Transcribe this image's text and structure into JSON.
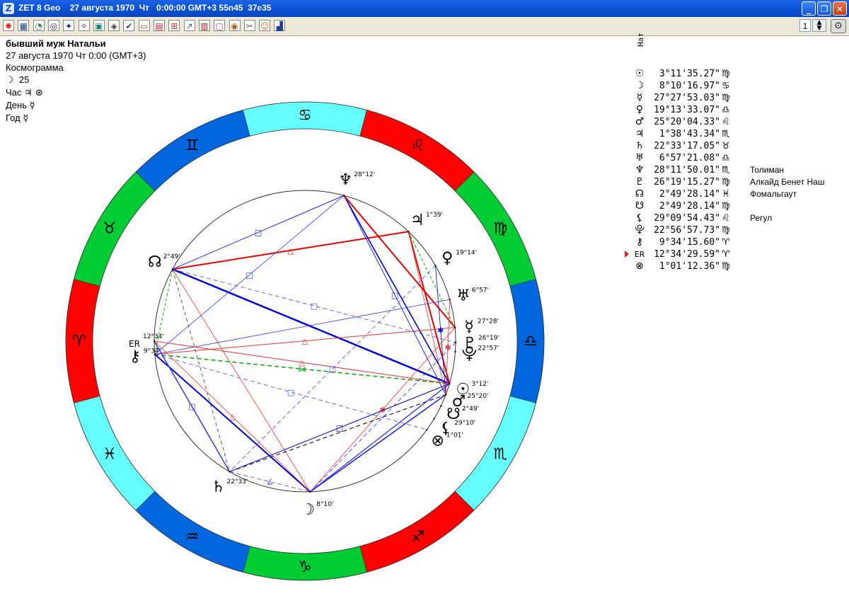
{
  "window": {
    "title": "ZET 8 Geo    27 августа 1970  Чт   0:00:00 GMT+3 55n45  37e35",
    "icon": "Z",
    "minimize": "_",
    "maximize": "❐",
    "close": "✕"
  },
  "toolbar": {
    "buttons": [
      {
        "name": "sun-tool-icon",
        "glyph": "✺",
        "color": "#d02010"
      },
      {
        "name": "table-tool-icon",
        "glyph": "▦",
        "color": "#204080"
      },
      {
        "name": "pie-tool-icon",
        "glyph": "◔",
        "color": "#208040"
      },
      {
        "name": "circle-tool-icon",
        "glyph": "◎",
        "color": "#202060"
      },
      {
        "name": "star-map-icon",
        "glyph": "✦",
        "color": "#1030a0"
      },
      {
        "name": "night-sky-icon",
        "glyph": "✧",
        "color": "#102080"
      },
      {
        "name": "map-tool-icon",
        "glyph": "▣",
        "color": "#108060"
      },
      {
        "name": "diagram-tool-icon",
        "glyph": "◈",
        "color": "#404040"
      },
      {
        "name": "check-tool-icon",
        "glyph": "✔",
        "color": "#2040c0"
      },
      {
        "name": "folder-tool-icon",
        "glyph": "▭",
        "color": "#806020"
      },
      {
        "name": "grid-tool-icon",
        "glyph": "▤",
        "color": "#c02020"
      },
      {
        "name": "plus-grid-icon",
        "glyph": "⊞",
        "color": "#c03030"
      },
      {
        "name": "arrow-tool-icon",
        "glyph": "↗",
        "color": "#2060a0"
      },
      {
        "name": "calc-tool-icon",
        "glyph": "▥",
        "color": "#a02020"
      },
      {
        "name": "doc-tool-icon",
        "glyph": "▢",
        "color": "#8040a0"
      },
      {
        "name": "zodiac-wheel-icon",
        "glyph": "◉",
        "color": "#a06020"
      },
      {
        "name": "tools-icon",
        "glyph": "✂",
        "color": "#606060"
      },
      {
        "name": "person-tool-icon",
        "glyph": "☺",
        "color": "#c07020"
      },
      {
        "name": "chart-bars-icon",
        "glyph": "▟",
        "color": "#2040a0"
      }
    ],
    "page_number": "1",
    "spin_up": "▲",
    "spin_down": "▼",
    "zoom": "⊙"
  },
  "info": {
    "name": "бывший муж Натальи",
    "date_line": "27 августа 1970  Чт   0:00 (GMT+3)",
    "chart_type": "Космограмма",
    "moon_symbol": "☽",
    "moon_day": "25",
    "hour_label": "Час",
    "hour_symbols": "♃ ⊛",
    "day_label": "День",
    "day_symbol": "☿",
    "year_label": "Год",
    "year_symbol": "☿"
  },
  "table_header": "Нат",
  "planets": [
    {
      "glyph": "☉",
      "deg": "3°11'35.27\"",
      "sign": "♍",
      "star": ""
    },
    {
      "glyph": "☽",
      "deg": "8°10'16.97\"",
      "sign": "♋",
      "star": ""
    },
    {
      "glyph": "☿",
      "deg": "27°27'53.03\"",
      "sign": "♍",
      "star": ""
    },
    {
      "glyph": "♀",
      "deg": "19°13'33.07\"",
      "sign": "♎",
      "star": ""
    },
    {
      "glyph": "♂",
      "deg": "25°20'04.33\"",
      "sign": "♌",
      "star": ""
    },
    {
      "glyph": "♃",
      "deg": "1°38'43.34\"",
      "sign": "♏",
      "star": ""
    },
    {
      "glyph": "♄",
      "deg": "22°33'17.05\"",
      "sign": "♉",
      "star": ""
    },
    {
      "glyph": "♅",
      "deg": "6°57'21.08\"",
      "sign": "♎",
      "star": ""
    },
    {
      "glyph": "♆",
      "deg": "28°11'50.01\"",
      "sign": "♏",
      "star": "Толиман"
    },
    {
      "glyph": "♇",
      "deg": "26°19'15.27\"",
      "sign": "♍",
      "star": "Алкайд Бенет Наш"
    },
    {
      "glyph": "☊",
      "deg": "2°49'28.14\"",
      "sign": "♓",
      "star": "Фомальгаут"
    },
    {
      "glyph": "☋",
      "deg": "2°49'28.14\"",
      "sign": "♍",
      "star": ""
    },
    {
      "glyph": "⚸",
      "deg": "29°09'54.43\"",
      "sign": "♌",
      "star": "Регул"
    },
    {
      "glyph": "⯓",
      "deg": "22°56'57.73\"",
      "sign": "♍",
      "star": ""
    },
    {
      "glyph": "⚷",
      "deg": "9°34'15.60\"",
      "sign": "♈",
      "star": ""
    },
    {
      "glyph": "ER",
      "deg": "12°34'29.59\"",
      "sign": "♈",
      "star": "",
      "marked": true
    },
    {
      "glyph": "⊗",
      "deg": "1°01'12.36\"",
      "sign": "♍",
      "star": ""
    }
  ],
  "zodiac": {
    "signs": [
      {
        "glyph": "♈",
        "color": "#ff0000"
      },
      {
        "glyph": "♉",
        "color": "#00cc33"
      },
      {
        "glyph": "♊",
        "color": "#0066dd"
      },
      {
        "glyph": "♋",
        "color": "#66ffff"
      },
      {
        "glyph": "♌",
        "color": "#ff0000"
      },
      {
        "glyph": "♍",
        "color": "#00cc33"
      },
      {
        "glyph": "♎",
        "color": "#0066dd"
      },
      {
        "glyph": "♏",
        "color": "#66ffff"
      },
      {
        "glyph": "♐",
        "color": "#ff0000"
      },
      {
        "glyph": "♑",
        "color": "#00cc33"
      },
      {
        "glyph": "♒",
        "color": "#0066dd"
      },
      {
        "glyph": "♓",
        "color": "#66ffff"
      }
    ]
  },
  "chart_points": [
    {
      "id": "sun",
      "glyph": "☉",
      "label": "3°12'",
      "angle": -16.4
    },
    {
      "id": "moon",
      "glyph": "☽",
      "label": "8°10'",
      "angle": -88
    },
    {
      "id": "mars",
      "glyph": "♂",
      "label": "25°20'",
      "angle": -20.8
    },
    {
      "id": "mercury",
      "glyph": "☿",
      "label": "27°28'",
      "angle": 5.2
    },
    {
      "id": "venus",
      "glyph": "♀",
      "label": "19°14'",
      "angle": 30
    },
    {
      "id": "jupiter",
      "glyph": "♃",
      "label": "1°39'",
      "angle": 46.6
    },
    {
      "id": "saturn",
      "glyph": "♄",
      "label": "22°33'",
      "angle": -120
    },
    {
      "id": "uranus",
      "glyph": "♅",
      "label": "6°57'",
      "angle": 16
    },
    {
      "id": "neptune",
      "glyph": "♆",
      "label": "28°12'",
      "angle": 75
    },
    {
      "id": "pluto",
      "glyph": "♇",
      "label": "26°19'",
      "angle": -0.5
    },
    {
      "id": "north-node",
      "glyph": "☊",
      "label": "2°49'",
      "angle": 151.5
    },
    {
      "id": "south-node",
      "glyph": "☋",
      "label": "2°49'",
      "angle": -25.5
    },
    {
      "id": "lilith",
      "glyph": "⚸",
      "label": "29°10'",
      "angle": -31
    },
    {
      "id": "proserpina",
      "glyph": "⯓",
      "label": "22°57'",
      "angle": -4
    },
    {
      "id": "chiron",
      "glyph": "⚷",
      "label": "9°34'",
      "angle": -175
    },
    {
      "id": "eris",
      "glyph": "ER",
      "label": "12°34'",
      "angle": -180
    },
    {
      "id": "part-fortune",
      "glyph": "⊗",
      "label": "1°01'",
      "angle": -36
    }
  ],
  "aspects": [
    {
      "a": "north-node",
      "b": "sun",
      "color": "#0000dd",
      "w": 2.5,
      "dash": ""
    },
    {
      "a": "north-node",
      "b": "jupiter",
      "color": "#ee0000",
      "w": 2,
      "dash": "",
      "mark": "△"
    },
    {
      "a": "north-node",
      "b": "neptune",
      "color": "#2222ff",
      "w": 1,
      "dash": "",
      "mark": "□"
    },
    {
      "a": "north-node",
      "b": "moon",
      "color": "#ee3333",
      "w": 0.8,
      "dash": ""
    },
    {
      "a": "north-node",
      "b": "saturn",
      "color": "#333333",
      "w": 0.8,
      "dash": "5,4"
    },
    {
      "a": "north-node",
      "b": "chiron",
      "color": "#00aa00",
      "w": 1,
      "dash": "4,3"
    },
    {
      "a": "north-node",
      "b": "pluto",
      "color": "#4444ff",
      "w": 0.8,
      "dash": "6,4",
      "mark": "□"
    },
    {
      "a": "neptune",
      "b": "sun",
      "color": "#0000dd",
      "w": 1.6,
      "dash": ""
    },
    {
      "a": "neptune",
      "b": "mars",
      "color": "#2222ff",
      "w": 1,
      "dash": "",
      "mark": "□"
    },
    {
      "a": "neptune",
      "b": "mercury",
      "color": "#ee0000",
      "w": 2,
      "dash": ""
    },
    {
      "a": "neptune",
      "b": "chiron",
      "color": "#3333ff",
      "w": 0.8,
      "dash": "",
      "mark": "□"
    },
    {
      "a": "jupiter",
      "b": "sun",
      "color": "#ee0000",
      "w": 2,
      "dash": ""
    },
    {
      "a": "jupiter",
      "b": "mercury",
      "color": "#00aa00",
      "w": 1,
      "dash": "4,3"
    },
    {
      "a": "chiron",
      "b": "sun",
      "color": "#00aa00",
      "w": 1.5,
      "dash": "6,4",
      "mark": "⋈"
    },
    {
      "a": "chiron",
      "b": "uranus",
      "color": "#3333ff",
      "w": 0.8,
      "dash": ""
    },
    {
      "a": "chiron",
      "b": "moon",
      "color": "#0000dd",
      "w": 2,
      "dash": ""
    },
    {
      "a": "chiron",
      "b": "mercury",
      "color": "#ee3333",
      "w": 1,
      "dash": "",
      "mark": "△"
    },
    {
      "a": "chiron",
      "b": "part-fortune",
      "color": "#4444ff",
      "w": 0.8,
      "dash": "6,4",
      "mark": "□"
    },
    {
      "a": "moon",
      "b": "mars",
      "color": "#2222ff",
      "w": 1.6,
      "dash": ""
    },
    {
      "a": "moon",
      "b": "sun",
      "color": "#2222ff",
      "w": 1.2,
      "dash": ""
    },
    {
      "a": "moon",
      "b": "mercury",
      "color": "#ee3333",
      "w": 0.8,
      "dash": "",
      "mark": "✱"
    },
    {
      "a": "moon",
      "b": "eris",
      "color": "#ee3333",
      "w": 0.8,
      "dash": "",
      "mark": "△"
    },
    {
      "a": "saturn",
      "b": "mars",
      "color": "#222222",
      "w": 1.2,
      "dash": "6,4"
    },
    {
      "a": "saturn",
      "b": "sun",
      "color": "#0000dd",
      "w": 1,
      "dash": "",
      "mark": "□"
    },
    {
      "a": "saturn",
      "b": "eris",
      "color": "#3333ff",
      "w": 1.5,
      "dash": "",
      "mark": "□"
    },
    {
      "a": "saturn",
      "b": "moon",
      "color": "#4444ff",
      "w": 0.8,
      "dash": "6,4",
      "mark": "∠"
    },
    {
      "a": "eris",
      "b": "sun",
      "color": "#ee3333",
      "w": 1,
      "dash": "",
      "mark": "△"
    },
    {
      "a": "mars",
      "b": "venus",
      "color": "#0000dd",
      "w": 0.8,
      "dash": "",
      "mark": "✱"
    },
    {
      "a": "mars",
      "b": "jupiter",
      "color": "#ee3333",
      "w": 0.8,
      "dash": ""
    },
    {
      "a": "pluto",
      "b": "moon",
      "color": "#2222ff",
      "w": 0.8,
      "dash": "6,4"
    },
    {
      "a": "uranus",
      "b": "mars",
      "color": "#ee3333",
      "w": 0.8,
      "dash": "",
      "mark": "✱"
    },
    {
      "a": "venus",
      "b": "saturn",
      "color": "#4444ff",
      "w": 0.8,
      "dash": "6,4",
      "mark": "□"
    }
  ]
}
